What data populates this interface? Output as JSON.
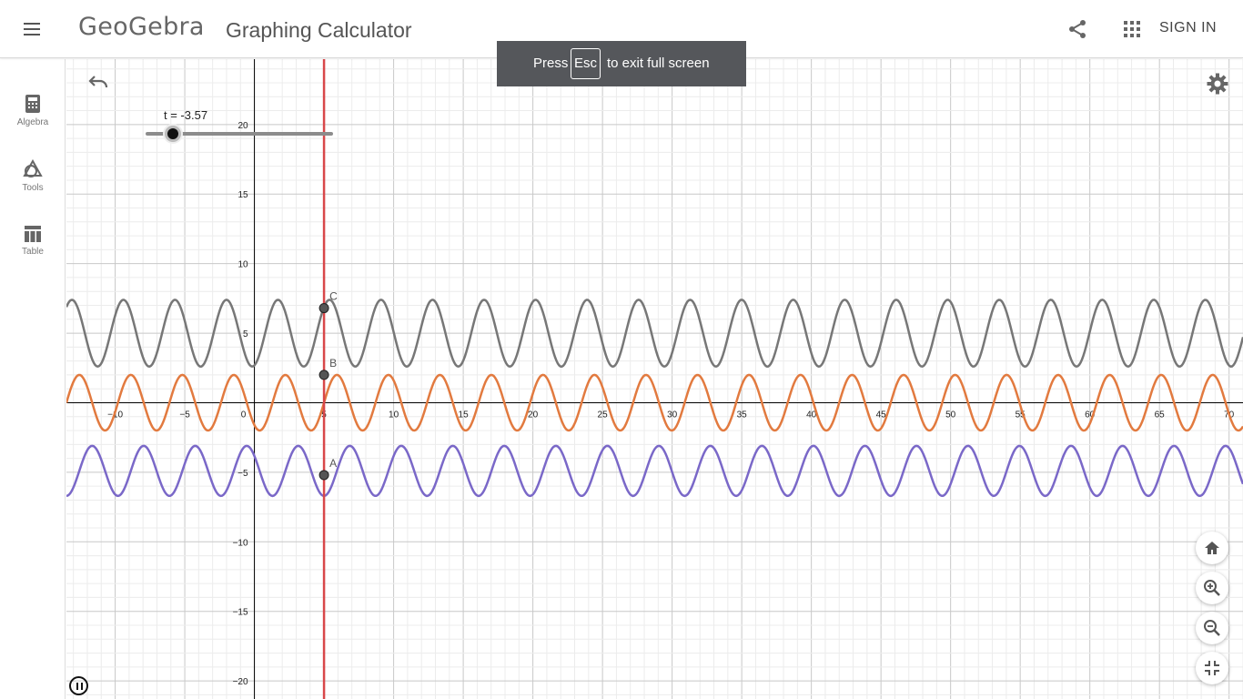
{
  "header": {
    "logo_text": "GeoGebra",
    "app_title": "Graphing Calculator",
    "signin_label": "SIGN IN",
    "icons": [
      "menu-icon",
      "share-icon",
      "apps-grid-icon"
    ]
  },
  "sidebar": {
    "items": [
      {
        "label": "Algebra",
        "icon": "calculator-icon"
      },
      {
        "label": "Tools",
        "icon": "shapes-icon"
      },
      {
        "label": "Table",
        "icon": "table-icon"
      }
    ]
  },
  "toast": {
    "prefix": "Press",
    "key": "Esc",
    "suffix": "to exit full screen"
  },
  "slider": {
    "label": "t = -3.57",
    "value": -3.57
  },
  "colors": {
    "vertical_line": "#d8474a",
    "curve_A": "#7a68c8",
    "curve_B": "#e27a3f",
    "curve_C": "#777777",
    "axis": "#000000"
  },
  "graph": {
    "x_ticks": [
      "−10",
      "−5",
      "0",
      "5",
      "10",
      "15",
      "20",
      "25",
      "30",
      "35",
      "40",
      "45",
      "50",
      "55",
      "60",
      "65",
      "70"
    ],
    "y_ticks": [
      "20",
      "15",
      "10",
      "5",
      "−5",
      "−10",
      "−15",
      "−20"
    ],
    "x_range": [
      -13.5,
      71
    ],
    "y_range": [
      -21.3,
      24.7
    ],
    "points": [
      {
        "name": "C",
        "x": 5,
        "y": 6.8
      },
      {
        "name": "B",
        "x": 5,
        "y": 2
      },
      {
        "name": "A",
        "x": 5,
        "y": -5.2
      }
    ],
    "vertical_line_x": 5,
    "curves": [
      {
        "name": "C",
        "center": 5,
        "amplitude": 2.4,
        "period": 3.7
      },
      {
        "name": "B",
        "center": 0,
        "amplitude": 2,
        "period": 3.7
      },
      {
        "name": "A",
        "center": -4.9,
        "amplitude": 1.8,
        "period": 3.7
      }
    ]
  },
  "controls": [
    "home-icon",
    "zoom-in-icon",
    "zoom-out-icon",
    "exit-fullscreen-icon",
    "undo-icon",
    "settings-icon",
    "pause-icon"
  ]
}
